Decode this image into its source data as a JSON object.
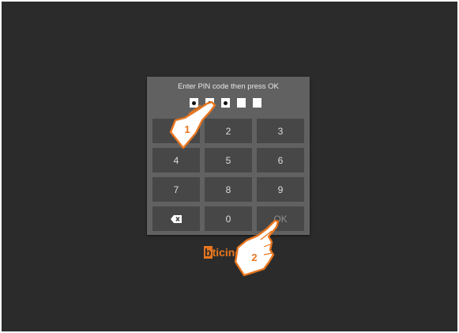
{
  "prompt": "Enter PIN code then press OK",
  "pin": {
    "length": 5,
    "filled": 3
  },
  "keypad": {
    "keys": [
      {
        "label": "1",
        "name": "key-1"
      },
      {
        "label": "2",
        "name": "key-2"
      },
      {
        "label": "3",
        "name": "key-3"
      },
      {
        "label": "4",
        "name": "key-4"
      },
      {
        "label": "5",
        "name": "key-5"
      },
      {
        "label": "6",
        "name": "key-6"
      },
      {
        "label": "7",
        "name": "key-7"
      },
      {
        "label": "8",
        "name": "key-8"
      },
      {
        "label": "9",
        "name": "key-9"
      },
      {
        "label": "",
        "name": "key-backspace",
        "icon": "backspace-icon"
      },
      {
        "label": "0",
        "name": "key-0"
      },
      {
        "label": "OK",
        "name": "key-ok"
      }
    ]
  },
  "logo": {
    "first": "b",
    "rest": "ticino"
  },
  "callouts": {
    "step1": "1",
    "step2": "2"
  },
  "colors": {
    "screen": "#2b2b2b",
    "panel": "#616161",
    "key": "#474747",
    "accent": "#e8761f"
  }
}
